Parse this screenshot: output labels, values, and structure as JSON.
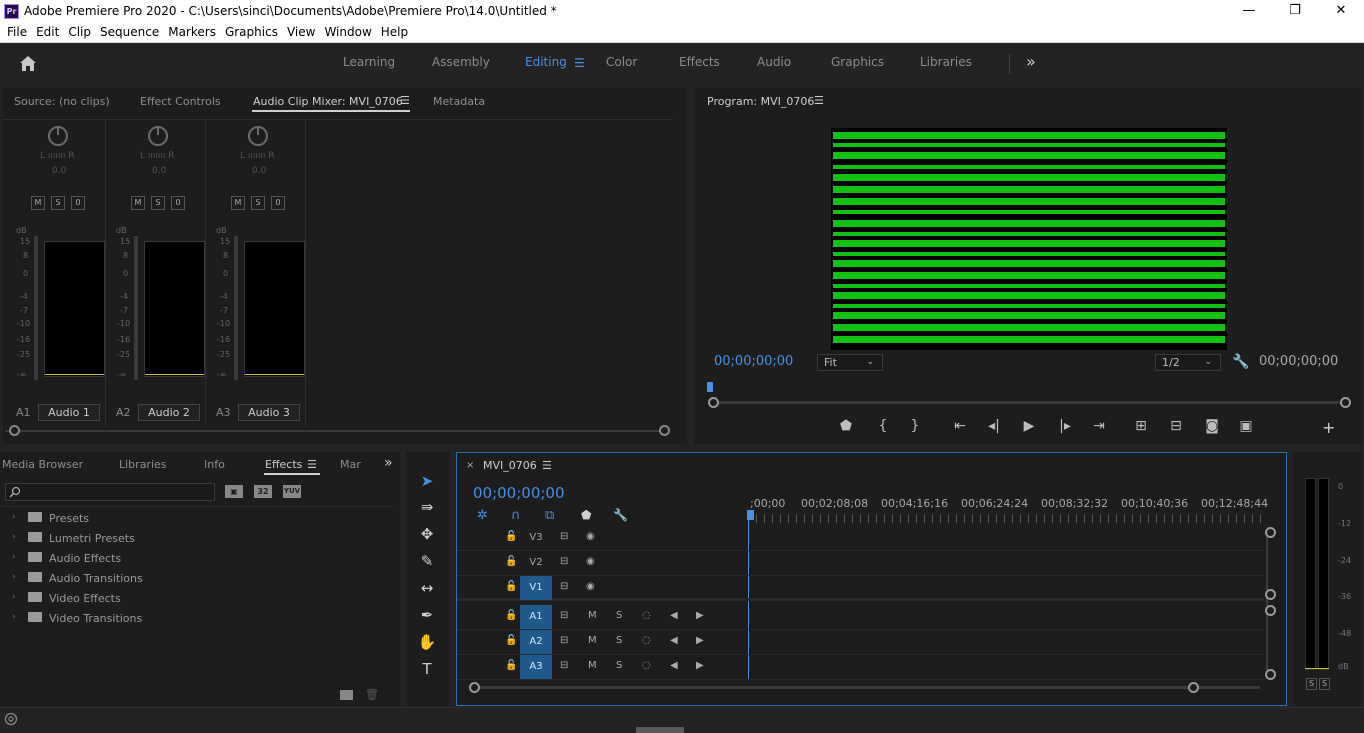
{
  "window": {
    "title": "Adobe Premiere Pro 2020 - C:\\Users\\sinci\\Documents\\Adobe\\Premiere Pro\\14.0\\Untitled *",
    "logo": "Pr",
    "minimize": "—",
    "restore": "❐",
    "close": "✕"
  },
  "menu": [
    "File",
    "Edit",
    "Clip",
    "Sequence",
    "Markers",
    "Graphics",
    "View",
    "Window",
    "Help"
  ],
  "workspaces": {
    "home_icon": "home-icon",
    "items": [
      "Learning",
      "Assembly",
      "Editing",
      "Color",
      "Effects",
      "Audio",
      "Graphics",
      "Libraries"
    ],
    "active": "Editing",
    "more": "»"
  },
  "source_panel": {
    "tabs": [
      "Source: (no clips)",
      "Effect Controls",
      "Audio Clip Mixer: MVI_0706",
      "Metadata"
    ],
    "active_tab": "Audio Clip Mixer: MVI_0706",
    "channels": [
      {
        "id": "A1",
        "name": "Audio 1",
        "pan_label": "L ııııııı R",
        "pan_value": "0.0"
      },
      {
        "id": "A2",
        "name": "Audio 2",
        "pan_label": "L ııııııı R",
        "pan_value": "0.0"
      },
      {
        "id": "A3",
        "name": "Audio 3",
        "pan_label": "L ııııııı R",
        "pan_value": "0.0"
      }
    ],
    "buttons": [
      "M",
      "S",
      "0"
    ],
    "db_label": "dB",
    "db_scale": [
      "15",
      "8",
      "0",
      "-4",
      "-7",
      "-10",
      "-16",
      "-25",
      "-∞"
    ]
  },
  "program_monitor": {
    "title": "Program: MVI_0706",
    "timecode_left": "00;00;00;00",
    "timecode_right": "00;00;00;00",
    "fit": "Fit",
    "resolution": "1/2",
    "controls": [
      "marker-icon",
      "mark-in-icon",
      "mark-out-icon",
      "go-to-in-icon",
      "step-back-icon",
      "play-icon",
      "step-forward-icon",
      "go-to-out-icon",
      "insert-icon",
      "overwrite-icon",
      "export-frame-icon",
      "comparison-view-icon"
    ],
    "add": "+"
  },
  "project_panel": {
    "tabs": [
      "Media Browser",
      "Libraries",
      "Info",
      "Effects",
      "Mar"
    ],
    "active_tab": "Effects",
    "search_placeholder": "",
    "filter_badges": [
      "▣",
      "32",
      "YUV"
    ],
    "effects": [
      "Presets",
      "Lumetri Presets",
      "Audio Effects",
      "Audio Transitions",
      "Video Effects",
      "Video Transitions"
    ]
  },
  "timeline": {
    "tab": "MVI_0706",
    "timecode": "00;00;00;00",
    "ruler": [
      ";00;00",
      "00;02;08;08",
      "00;04;16;16",
      "00;06;24;24",
      "00;08;32;32",
      "00;10;40;36",
      "00;12;48;44"
    ],
    "video_tracks": [
      "V3",
      "V2",
      "V1"
    ],
    "audio_tracks": [
      "A1",
      "A2",
      "A3"
    ],
    "audio_buttons": [
      "M",
      "S"
    ]
  },
  "audio_meter": {
    "scale": [
      "0",
      "-12",
      "-24",
      "-36",
      "-48",
      "dB"
    ],
    "solo": [
      "S",
      "S"
    ]
  }
}
